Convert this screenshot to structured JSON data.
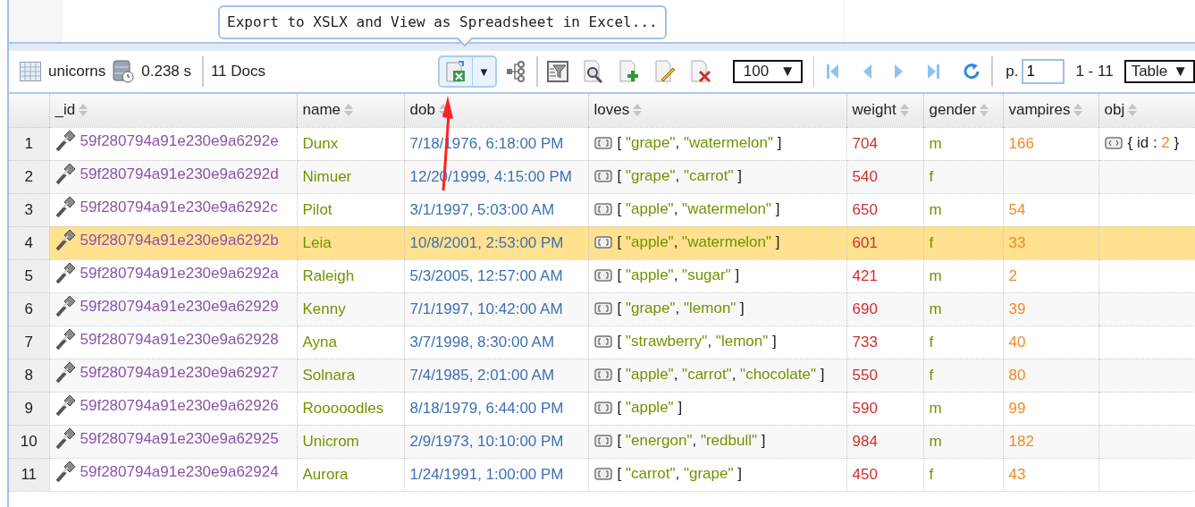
{
  "tooltip": {
    "text": "Export to XSLX and View as Spreadsheet in Excel..."
  },
  "toolbar": {
    "collection": "unicorns",
    "time": "0.238 s",
    "docs": "11 Docs",
    "export_hovered": true,
    "export_caret": "▼",
    "page_size": "100",
    "page_size_caret": "▼",
    "page_label": "p.",
    "page": "1",
    "range": "1 - 11",
    "view": "Table",
    "view_caret": "▼"
  },
  "table": {
    "columns": [
      "_id",
      "name",
      "dob",
      "loves",
      "weight",
      "gender",
      "vampires",
      "obj"
    ],
    "rows": [
      {
        "num": "1",
        "id": "59f280794a91e230e9a6292e",
        "name": "Dunx",
        "dob": "7/18/1976, 6:18:00 PM",
        "loves": [
          "[",
          "\"grape\"",
          ",",
          "\"watermelon\"",
          "]"
        ],
        "weight": "704",
        "gender": "m",
        "vampires": "166",
        "obj": [
          "{",
          "id",
          ":",
          "2",
          "}"
        ],
        "selected": false
      },
      {
        "num": "2",
        "id": "59f280794a91e230e9a6292d",
        "name": "Nimuer",
        "dob": "12/20/1999, 4:15:00 PM",
        "loves": [
          "[",
          "\"grape\"",
          ",",
          "\"carrot\"",
          "]"
        ],
        "weight": "540",
        "gender": "f",
        "selected": false
      },
      {
        "num": "3",
        "id": "59f280794a91e230e9a6292c",
        "name": "Pilot",
        "dob": "3/1/1997, 5:03:00 AM",
        "loves": [
          "[",
          "\"apple\"",
          ",",
          "\"watermelon\"",
          "]"
        ],
        "weight": "650",
        "gender": "m",
        "vampires": "54",
        "selected": false
      },
      {
        "num": "4",
        "id": "59f280794a91e230e9a6292b",
        "name": "Leia",
        "dob": "10/8/2001, 2:53:00 PM",
        "loves": [
          "[",
          "\"apple\"",
          ",",
          "\"watermelon\"",
          "]"
        ],
        "weight": "601",
        "gender": "f",
        "vampires": "33",
        "selected": true
      },
      {
        "num": "5",
        "id": "59f280794a91e230e9a6292a",
        "name": "Raleigh",
        "dob": "5/3/2005, 12:57:00 AM",
        "loves": [
          "[",
          "\"apple\"",
          ",",
          "\"sugar\"",
          "]"
        ],
        "weight": "421",
        "gender": "m",
        "vampires": "2",
        "selected": false
      },
      {
        "num": "6",
        "id": "59f280794a91e230e9a62929",
        "name": "Kenny",
        "dob": "7/1/1997, 10:42:00 AM",
        "loves": [
          "[",
          "\"grape\"",
          ",",
          "\"lemon\"",
          "]"
        ],
        "weight": "690",
        "gender": "m",
        "vampires": "39",
        "selected": false
      },
      {
        "num": "7",
        "id": "59f280794a91e230e9a62928",
        "name": "Ayna",
        "dob": "3/7/1998, 8:30:00 AM",
        "loves": [
          "[",
          "\"strawberry\"",
          ",",
          "\"lemon\"",
          "]"
        ],
        "weight": "733",
        "gender": "f",
        "vampires": "40",
        "selected": false
      },
      {
        "num": "8",
        "id": "59f280794a91e230e9a62927",
        "name": "Solnara",
        "dob": "7/4/1985, 2:01:00 AM",
        "loves": [
          "[",
          "\"apple\"",
          ",",
          "\"carrot\"",
          ",",
          "\"chocolate\"",
          "]"
        ],
        "weight": "550",
        "gender": "f",
        "vampires": "80",
        "selected": false
      },
      {
        "num": "9",
        "id": "59f280794a91e230e9a62926",
        "name": "Rooooodles",
        "dob": "8/18/1979, 6:44:00 PM",
        "loves": [
          "[",
          "\"apple\"",
          "]"
        ],
        "weight": "590",
        "gender": "m",
        "vampires": "99",
        "selected": false
      },
      {
        "num": "10",
        "id": "59f280794a91e230e9a62925",
        "name": "Unicrom",
        "dob": "2/9/1973, 10:10:00 PM",
        "loves": [
          "[",
          "\"energon\"",
          ",",
          "\"redbull\"",
          "]"
        ],
        "weight": "984",
        "gender": "m",
        "vampires": "182",
        "selected": false
      },
      {
        "num": "11",
        "id": "59f280794a91e230e9a62924",
        "name": "Aurora",
        "dob": "1/24/1991, 1:00:00 PM",
        "loves": [
          "[",
          "\"carrot\"",
          ",",
          "\"grape\"",
          "]"
        ],
        "weight": "450",
        "gender": "f",
        "vampires": "43",
        "selected": false
      }
    ]
  }
}
